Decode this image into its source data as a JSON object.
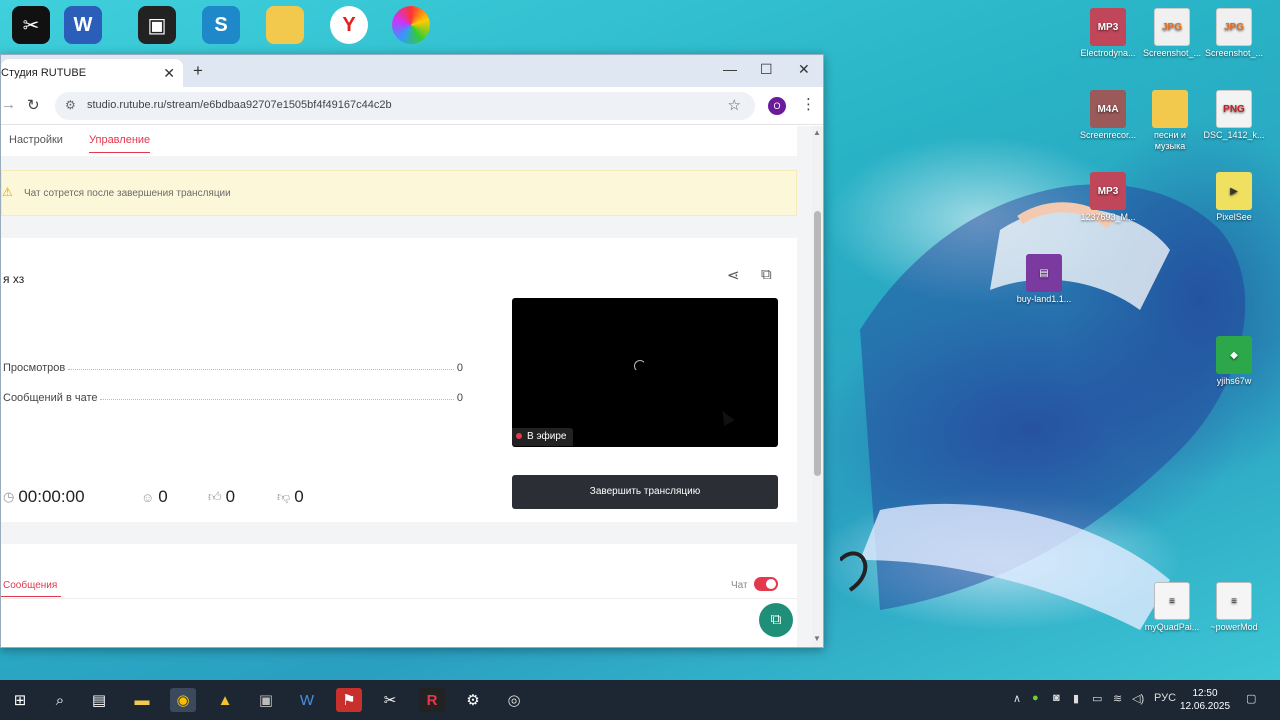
{
  "browser": {
    "tab_title": "Студия RUTUBE",
    "url": "studio.rutube.ru/stream/e6bdbaa92707e1505bf4f49167c44c2b",
    "profile_initial": "O"
  },
  "page": {
    "nav": {
      "settings": "Настройки",
      "management": "Управление"
    },
    "warning": "Чат сотрется после завершения трансляции",
    "stream_title": "я хз",
    "stats": [
      {
        "label": "Просмотров",
        "value": "0"
      },
      {
        "label": "Сообщений в чате",
        "value": "0"
      }
    ],
    "live_badge": "В эфире",
    "end_button": "Завершить трансляцию",
    "metrics": {
      "duration": "00:00:00",
      "viewers": "0",
      "likes": "0",
      "dislikes": "0"
    },
    "messages_tab": "Сообщения",
    "chat_toggle_label": "Чат",
    "chat_enabled": true
  },
  "desktop": {
    "top_icons": [
      "CapCut",
      "Word",
      "Roblox",
      "Skype",
      "",
      "Yandex",
      "360 Extreme"
    ],
    "icons": [
      {
        "type": "MP3",
        "label": "Electrodyna..."
      },
      {
        "type": "JPG",
        "label": "Screenshot_..."
      },
      {
        "type": "JPG",
        "label": "Screenshot_..."
      },
      {
        "type": "M4A",
        "label": "Screenrecor..."
      },
      {
        "type": "folder",
        "label": "песни и музыка"
      },
      {
        "type": "PNG",
        "label": "DSC_1412_k..."
      },
      {
        "type": "MP3",
        "label": "1237693_M..."
      },
      {
        "type": "pix",
        "label": "PixelSee"
      },
      {
        "type": "rar",
        "label": "buy-land1.1..."
      },
      {
        "type": "green",
        "label": "yjihs67w"
      },
      {
        "type": "txt",
        "label": "myQuadPai..."
      },
      {
        "type": "txt",
        "label": "~powerMod"
      }
    ]
  },
  "taskbar": {
    "language": "РУС",
    "time": "12:50",
    "date": "12.06.2025"
  },
  "colors": {
    "accent": "#e3384e",
    "end_button": "#2b2f35",
    "fab": "#1f8f7a"
  }
}
